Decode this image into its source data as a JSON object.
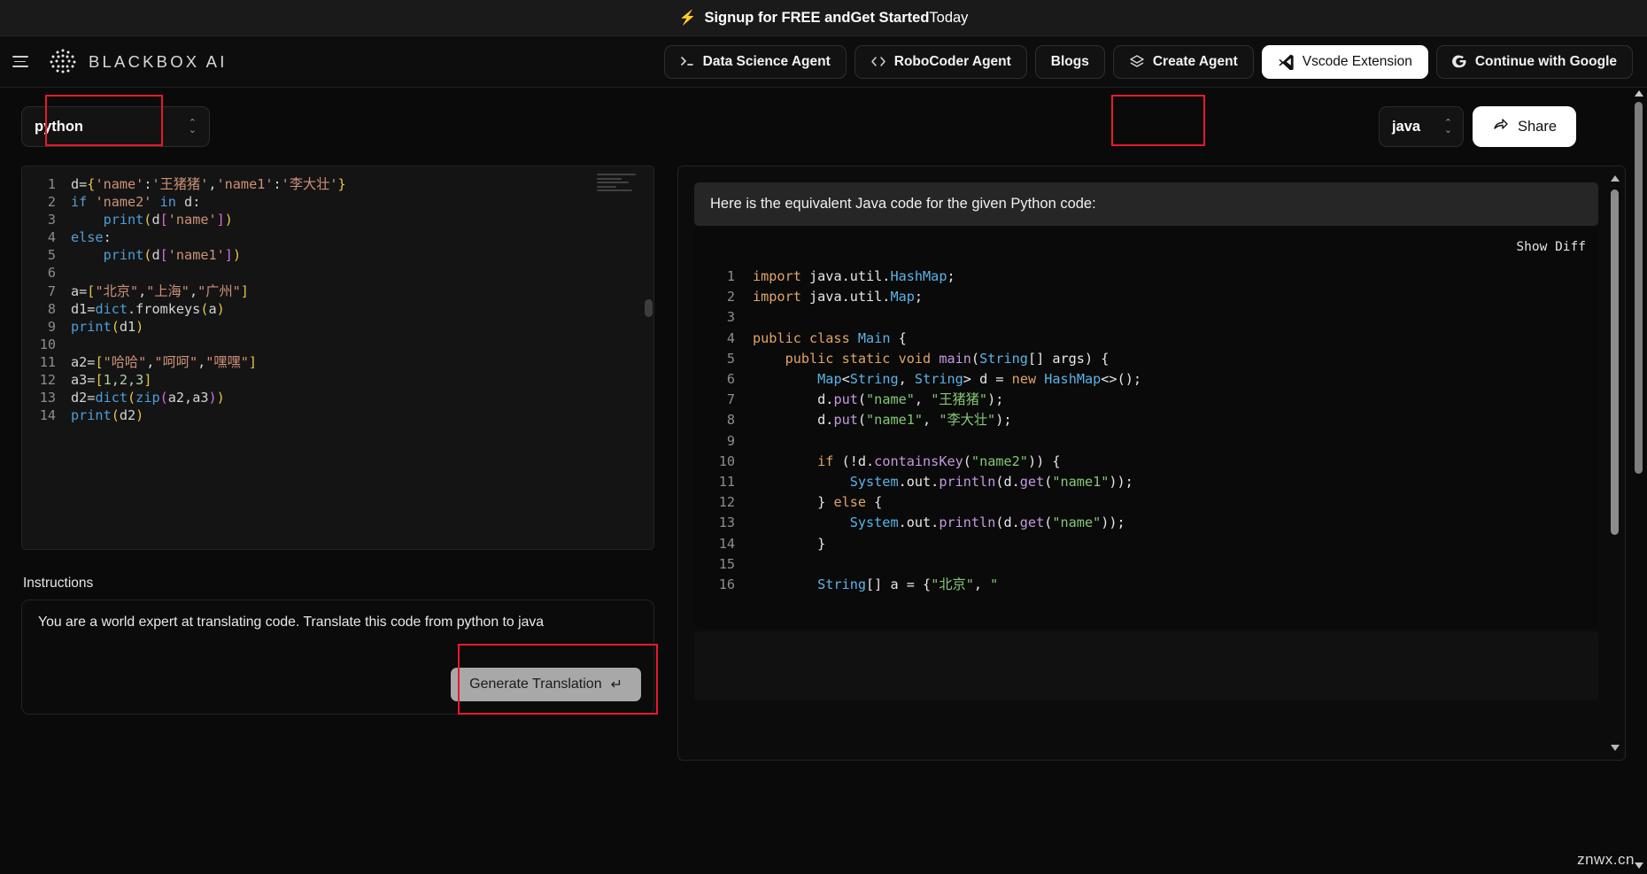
{
  "promo": {
    "icon": "lightning-bolt-icon",
    "text_strong_1": "Signup for FREE and ",
    "text_strong_2": "Get Started",
    "text_light": " Today"
  },
  "nav": {
    "menu_icon": "hamburger-menu-icon",
    "brand": "BLACKBOX AI",
    "buttons": [
      {
        "label": "Data Science Agent",
        "icon": "terminal-prompt-icon",
        "style": "plain"
      },
      {
        "label": "RoboCoder Agent",
        "icon": "code-tags-icon",
        "style": "plain"
      },
      {
        "label": "Blogs",
        "icon": "",
        "style": "plain"
      },
      {
        "label": "Create Agent",
        "icon": "layers-icon",
        "style": "plain"
      },
      {
        "label": "Vscode Extension",
        "icon": "vscode-icon",
        "style": "light"
      },
      {
        "label": "Continue with Google",
        "icon": "google-g-icon",
        "style": "plain"
      }
    ]
  },
  "toolbar": {
    "source_language": "python",
    "target_language": "java",
    "share_label": "Share",
    "share_icon": "share-arrow-icon",
    "stepper_icon": "chevron-up-down-icon"
  },
  "editor": {
    "lines": [
      {
        "n": "1",
        "tokens": [
          {
            "t": "d=",
            "c": "t-op"
          },
          {
            "t": "{",
            "c": "t-br-y"
          },
          {
            "t": "'name'",
            "c": "t-str"
          },
          {
            "t": ":",
            "c": "t-op"
          },
          {
            "t": "'王猪猪'",
            "c": "t-str"
          },
          {
            "t": ",",
            "c": "t-op"
          },
          {
            "t": "'name1'",
            "c": "t-str"
          },
          {
            "t": ":",
            "c": "t-op"
          },
          {
            "t": "'李大壮'",
            "c": "t-str"
          },
          {
            "t": "}",
            "c": "t-br-y"
          }
        ]
      },
      {
        "n": "2",
        "tokens": [
          {
            "t": "if ",
            "c": "t-kw"
          },
          {
            "t": "'name2'",
            "c": "t-str"
          },
          {
            "t": " ",
            "c": "t-op"
          },
          {
            "t": "in",
            "c": "t-kw"
          },
          {
            "t": " d:",
            "c": "t-op"
          }
        ]
      },
      {
        "n": "3",
        "tokens": [
          {
            "t": "    ",
            "c": "t-op"
          },
          {
            "t": "print",
            "c": "t-fn"
          },
          {
            "t": "(",
            "c": "t-br-y"
          },
          {
            "t": "d",
            "c": "t-var"
          },
          {
            "t": "[",
            "c": "t-br-p"
          },
          {
            "t": "'name'",
            "c": "t-str"
          },
          {
            "t": "]",
            "c": "t-br-p"
          },
          {
            "t": ")",
            "c": "t-br-y"
          }
        ]
      },
      {
        "n": "4",
        "tokens": [
          {
            "t": "else",
            "c": "t-kw"
          },
          {
            "t": ":",
            "c": "t-op"
          }
        ]
      },
      {
        "n": "5",
        "tokens": [
          {
            "t": "    ",
            "c": "t-op"
          },
          {
            "t": "print",
            "c": "t-fn"
          },
          {
            "t": "(",
            "c": "t-br-y"
          },
          {
            "t": "d",
            "c": "t-var"
          },
          {
            "t": "[",
            "c": "t-br-p"
          },
          {
            "t": "'name1'",
            "c": "t-str"
          },
          {
            "t": "]",
            "c": "t-br-p"
          },
          {
            "t": ")",
            "c": "t-br-y"
          }
        ]
      },
      {
        "n": "6",
        "tokens": []
      },
      {
        "n": "7",
        "tokens": [
          {
            "t": "a=",
            "c": "t-op"
          },
          {
            "t": "[",
            "c": "t-br-y"
          },
          {
            "t": "\"北京\"",
            "c": "t-str"
          },
          {
            "t": ",",
            "c": "t-op"
          },
          {
            "t": "\"上海\"",
            "c": "t-str"
          },
          {
            "t": ",",
            "c": "t-op"
          },
          {
            "t": "\"广州\"",
            "c": "t-str"
          },
          {
            "t": "]",
            "c": "t-br-y"
          }
        ]
      },
      {
        "n": "8",
        "tokens": [
          {
            "t": "d1=",
            "c": "t-op"
          },
          {
            "t": "dict",
            "c": "t-fn"
          },
          {
            "t": ".fromkeys",
            "c": "t-op"
          },
          {
            "t": "(",
            "c": "t-br-y"
          },
          {
            "t": "a",
            "c": "t-var"
          },
          {
            "t": ")",
            "c": "t-br-y"
          }
        ]
      },
      {
        "n": "9",
        "tokens": [
          {
            "t": "print",
            "c": "t-fn"
          },
          {
            "t": "(",
            "c": "t-br-y"
          },
          {
            "t": "d1",
            "c": "t-var"
          },
          {
            "t": ")",
            "c": "t-br-y"
          }
        ]
      },
      {
        "n": "10",
        "tokens": []
      },
      {
        "n": "11",
        "tokens": [
          {
            "t": "a2=",
            "c": "t-op"
          },
          {
            "t": "[",
            "c": "t-br-y"
          },
          {
            "t": "\"哈哈\"",
            "c": "t-str"
          },
          {
            "t": ",",
            "c": "t-op"
          },
          {
            "t": "\"呵呵\"",
            "c": "t-str"
          },
          {
            "t": ",",
            "c": "t-op"
          },
          {
            "t": "\"嘿嘿\"",
            "c": "t-str"
          },
          {
            "t": "]",
            "c": "t-br-y"
          }
        ]
      },
      {
        "n": "12",
        "tokens": [
          {
            "t": "a3=",
            "c": "t-op"
          },
          {
            "t": "[",
            "c": "t-br-y"
          },
          {
            "t": "1,2,3",
            "c": "t-num"
          },
          {
            "t": "]",
            "c": "t-br-y"
          }
        ]
      },
      {
        "n": "13",
        "tokens": [
          {
            "t": "d2=",
            "c": "t-op"
          },
          {
            "t": "dict",
            "c": "t-fn"
          },
          {
            "t": "(",
            "c": "t-br-y"
          },
          {
            "t": "zip",
            "c": "t-fn"
          },
          {
            "t": "(",
            "c": "t-br-p"
          },
          {
            "t": "a2,a3",
            "c": "t-var"
          },
          {
            "t": ")",
            "c": "t-br-p"
          },
          {
            "t": ")",
            "c": "t-br-y"
          }
        ]
      },
      {
        "n": "14",
        "tokens": [
          {
            "t": "print",
            "c": "t-fn"
          },
          {
            "t": "(",
            "c": "t-br-y"
          },
          {
            "t": "d2",
            "c": "t-var"
          },
          {
            "t": ")",
            "c": "t-br-y"
          }
        ]
      }
    ]
  },
  "instructions": {
    "label": "Instructions",
    "value": "You are a world expert at translating code. Translate this code from python to java",
    "generate_label": "Generate Translation",
    "generate_icon": "return-key-icon"
  },
  "output": {
    "intro": "Here is the equivalent Java code for the given Python code:",
    "show_diff_label": "Show Diff",
    "lines": [
      {
        "n": "1",
        "tokens": [
          {
            "t": "import",
            "c": "j-kw"
          },
          {
            "t": " java.util.",
            "c": "j-plain"
          },
          {
            "t": "HashMap",
            "c": "j-type"
          },
          {
            "t": ";",
            "c": "j-plain"
          }
        ]
      },
      {
        "n": "2",
        "tokens": [
          {
            "t": "import",
            "c": "j-kw"
          },
          {
            "t": " java.util.",
            "c": "j-plain"
          },
          {
            "t": "Map",
            "c": "j-type"
          },
          {
            "t": ";",
            "c": "j-plain"
          }
        ]
      },
      {
        "n": "3",
        "tokens": []
      },
      {
        "n": "4",
        "tokens": [
          {
            "t": "public class",
            "c": "j-kw"
          },
          {
            "t": " ",
            "c": "j-plain"
          },
          {
            "t": "Main",
            "c": "j-type"
          },
          {
            "t": " {",
            "c": "j-plain"
          }
        ]
      },
      {
        "n": "5",
        "tokens": [
          {
            "t": "    ",
            "c": "j-plain"
          },
          {
            "t": "public static void",
            "c": "j-kw"
          },
          {
            "t": " ",
            "c": "j-plain"
          },
          {
            "t": "main",
            "c": "j-fn"
          },
          {
            "t": "(",
            "c": "j-plain"
          },
          {
            "t": "String",
            "c": "j-type"
          },
          {
            "t": "[] args) {",
            "c": "j-plain"
          }
        ]
      },
      {
        "n": "6",
        "tokens": [
          {
            "t": "        ",
            "c": "j-plain"
          },
          {
            "t": "Map",
            "c": "j-type"
          },
          {
            "t": "<",
            "c": "j-plain"
          },
          {
            "t": "String",
            "c": "j-type"
          },
          {
            "t": ", ",
            "c": "j-plain"
          },
          {
            "t": "String",
            "c": "j-type"
          },
          {
            "t": "> d = ",
            "c": "j-plain"
          },
          {
            "t": "new",
            "c": "j-kw"
          },
          {
            "t": " ",
            "c": "j-plain"
          },
          {
            "t": "HashMap",
            "c": "j-type"
          },
          {
            "t": "<>();",
            "c": "j-plain"
          }
        ]
      },
      {
        "n": "7",
        "tokens": [
          {
            "t": "        d.",
            "c": "j-plain"
          },
          {
            "t": "put",
            "c": "j-fn"
          },
          {
            "t": "(",
            "c": "j-plain"
          },
          {
            "t": "\"name\"",
            "c": "j-str"
          },
          {
            "t": ", ",
            "c": "j-plain"
          },
          {
            "t": "\"王猪猪\"",
            "c": "j-str"
          },
          {
            "t": ");",
            "c": "j-plain"
          }
        ]
      },
      {
        "n": "8",
        "tokens": [
          {
            "t": "        d.",
            "c": "j-plain"
          },
          {
            "t": "put",
            "c": "j-fn"
          },
          {
            "t": "(",
            "c": "j-plain"
          },
          {
            "t": "\"name1\"",
            "c": "j-str"
          },
          {
            "t": ", ",
            "c": "j-plain"
          },
          {
            "t": "\"李大壮\"",
            "c": "j-str"
          },
          {
            "t": ");",
            "c": "j-plain"
          }
        ]
      },
      {
        "n": "9",
        "tokens": []
      },
      {
        "n": "10",
        "tokens": [
          {
            "t": "        ",
            "c": "j-plain"
          },
          {
            "t": "if",
            "c": "j-kw"
          },
          {
            "t": " (!d.",
            "c": "j-plain"
          },
          {
            "t": "containsKey",
            "c": "j-fn"
          },
          {
            "t": "(",
            "c": "j-plain"
          },
          {
            "t": "\"name2\"",
            "c": "j-str"
          },
          {
            "t": ")) {",
            "c": "j-plain"
          }
        ]
      },
      {
        "n": "11",
        "tokens": [
          {
            "t": "            ",
            "c": "j-plain"
          },
          {
            "t": "System",
            "c": "j-type"
          },
          {
            "t": ".out.",
            "c": "j-plain"
          },
          {
            "t": "println",
            "c": "j-fn"
          },
          {
            "t": "(d.",
            "c": "j-plain"
          },
          {
            "t": "get",
            "c": "j-fn"
          },
          {
            "t": "(",
            "c": "j-plain"
          },
          {
            "t": "\"name1\"",
            "c": "j-str"
          },
          {
            "t": "));",
            "c": "j-plain"
          }
        ]
      },
      {
        "n": "12",
        "tokens": [
          {
            "t": "        } ",
            "c": "j-plain"
          },
          {
            "t": "else",
            "c": "j-kw"
          },
          {
            "t": " {",
            "c": "j-plain"
          }
        ]
      },
      {
        "n": "13",
        "tokens": [
          {
            "t": "            ",
            "c": "j-plain"
          },
          {
            "t": "System",
            "c": "j-type"
          },
          {
            "t": ".out.",
            "c": "j-plain"
          },
          {
            "t": "println",
            "c": "j-fn"
          },
          {
            "t": "(d.",
            "c": "j-plain"
          },
          {
            "t": "get",
            "c": "j-fn"
          },
          {
            "t": "(",
            "c": "j-plain"
          },
          {
            "t": "\"name\"",
            "c": "j-str"
          },
          {
            "t": "));",
            "c": "j-plain"
          }
        ]
      },
      {
        "n": "14",
        "tokens": [
          {
            "t": "        }",
            "c": "j-plain"
          }
        ]
      },
      {
        "n": "15",
        "tokens": []
      },
      {
        "n": "16",
        "tokens": [
          {
            "t": "        ",
            "c": "j-plain"
          },
          {
            "t": "String",
            "c": "j-type"
          },
          {
            "t": "[] a = {",
            "c": "j-plain"
          },
          {
            "t": "\"北京\"",
            "c": "j-str"
          },
          {
            "t": ", ",
            "c": "j-plain"
          },
          {
            "t": "\"",
            "c": "j-str"
          }
        ]
      }
    ]
  },
  "watermark": "znwx.cn",
  "colors": {
    "annotation": "#e8192c",
    "accent_yellow": "#f5c518",
    "panel_bg": "#0c0c0c"
  }
}
